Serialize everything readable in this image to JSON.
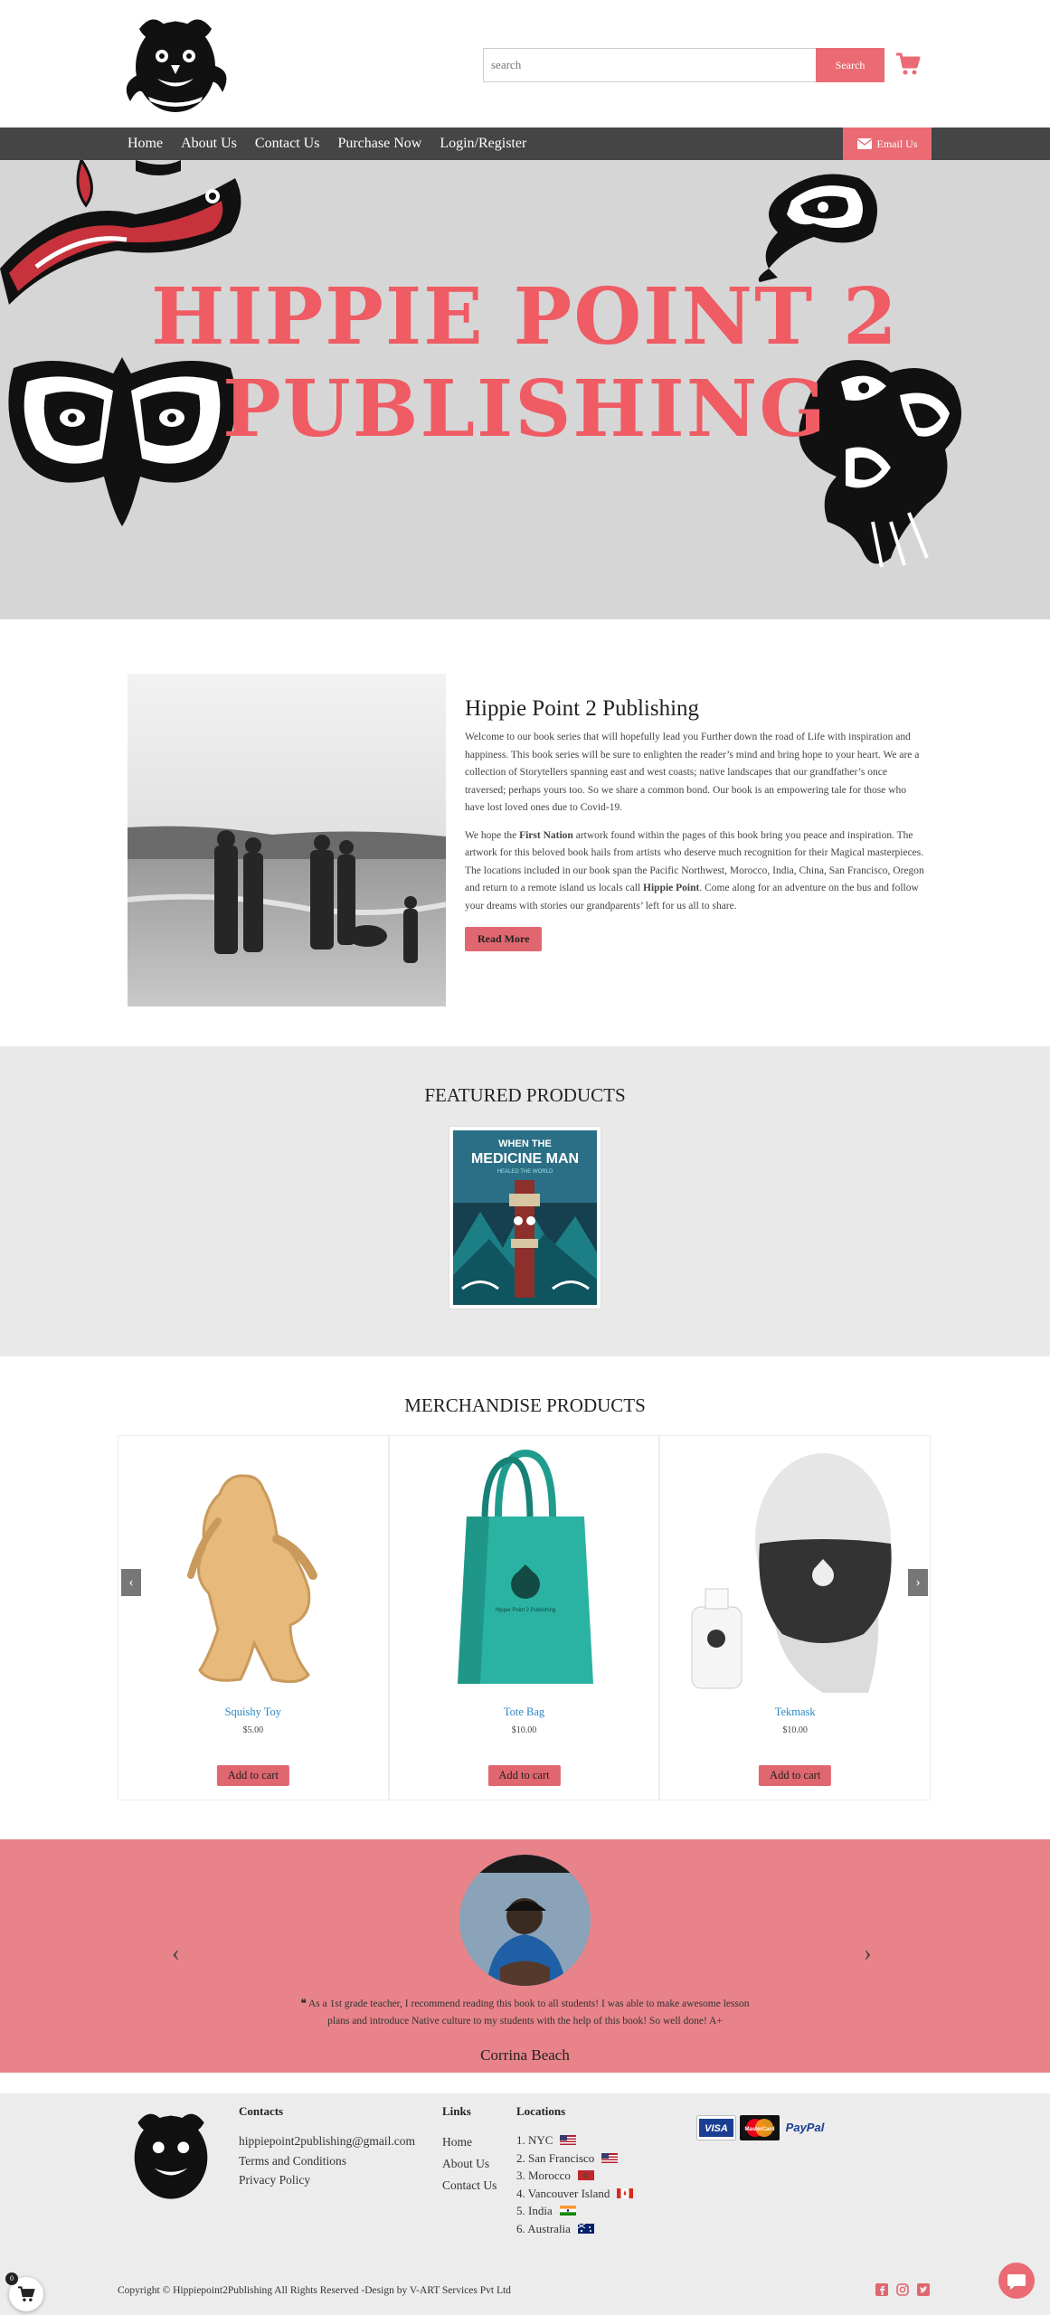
{
  "header": {
    "search_placeholder": "search",
    "search_button": "Search",
    "cart_icon": "shopping-cart-icon"
  },
  "nav": {
    "items": [
      "Home",
      "About Us",
      "Contact Us",
      "Purchase Now",
      "Login/Register"
    ],
    "email_button": "Email Us"
  },
  "hero": {
    "title_line1": "HIPPIE POINT 2",
    "title_line2": "PUBLISHING"
  },
  "about": {
    "title": "Hippie Point 2 Publishing",
    "p1": "Welcome to our book series that will hopefully lead you Further down the road of Life with inspiration and happiness. This book series will be sure to enlighten the reader’s mind and bring hope to your heart. We are a collection of Storytellers spanning east and west coasts; native landscapes that our grandfather’s once traversed; perhaps yours too. So we share a common bond. Our book is an empowering tale for those who have lost loved ones due to Covid-19.",
    "p2_a": "We hope the ",
    "p2_b": "First Nation",
    "p2_c": " artwork found within the pages of this book bring you peace and inspiration. The artwork for this beloved book hails from artists who deserve much recognition for their Magical masterpieces. The locations included in our book span the Pacific Northwest, Morocco, India, China, San Francisco, Oregon and return to a remote island us locals call ",
    "p2_d": "Hippie Point",
    "p2_e": ". Come along for an adventure on the bus and follow your dreams with stories our grandparents’ left for us all to share.",
    "read_more": "Read More"
  },
  "featured": {
    "title": "FEATURED PRODUCTS",
    "book_title_1": "WHEN THE",
    "book_title_2": "MEDICINE MAN",
    "book_subtitle": "HEALED THE WORLD"
  },
  "merch": {
    "title": "MERCHANDISE PRODUCTS",
    "products": [
      {
        "name": "Squishy Toy",
        "price": "$5.00",
        "button": "Add to cart"
      },
      {
        "name": "Tote Bag",
        "price": "$10.00",
        "button": "Add to cart"
      },
      {
        "name": "Tekmask",
        "price": "$10.00",
        "button": "Add to cart"
      }
    ],
    "bag_print": "Hippie Point 2 Publishing"
  },
  "testimonial": {
    "quote": "As a 1st grade teacher, I recommend reading this book to all students! I was able to make awesome lesson plans and introduce Native culture to my students with the help of this book! So well done! A+",
    "name": "Corrina Beach"
  },
  "footer": {
    "contacts_head": "Contacts",
    "contacts": [
      "hippiepoint2publishing@gmail.com",
      "Terms and Conditions",
      "Privacy Policy"
    ],
    "links_head": "Links",
    "links": [
      "Home",
      "About Us",
      "Contact Us"
    ],
    "locations_head": "Locations",
    "locations": [
      {
        "label": "1. NYC",
        "flag": "us-flag-icon"
      },
      {
        "label": "2. San Francisco",
        "flag": "us-flag-icon"
      },
      {
        "label": "3. Morocco",
        "flag": "morocco-flag-icon"
      },
      {
        "label": "4. Vancouver Island",
        "flag": "canada-flag-icon"
      },
      {
        "label": "5. India",
        "flag": "india-flag-icon"
      },
      {
        "label": "6. Australia",
        "flag": "australia-flag-icon"
      }
    ],
    "payments": [
      "VISA",
      "MasterCard",
      "PayPal"
    ],
    "copyright": "Copyright © Hippiepoint2Publishing All Rights Reserved -Design by V-ART Services Pvt Ltd",
    "cart_count": "0"
  },
  "colors": {
    "accent": "#ea6b73",
    "nav_bg": "#454545",
    "hero_title": "#ef5c64",
    "testimonial_bg": "#e8838a",
    "link": "#2a87c8"
  }
}
